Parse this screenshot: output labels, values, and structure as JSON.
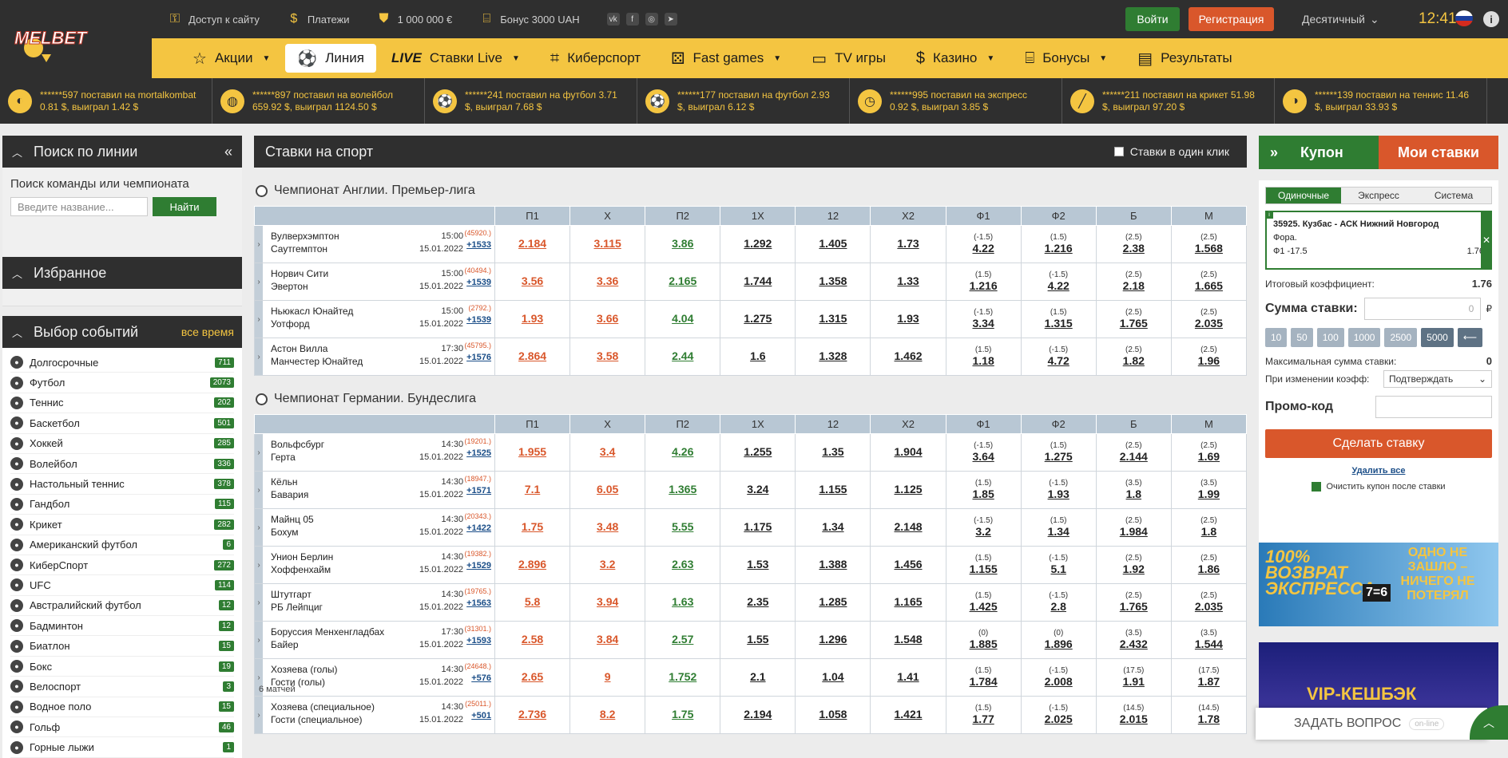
{
  "header": {
    "logo_text": "MELBET",
    "links": [
      {
        "icon": "key-icon",
        "label": "Доступ к сайту"
      },
      {
        "icon": "dollar-icon",
        "label": "Платежи"
      },
      {
        "icon": "shield-icon",
        "label": "1 000 000 €"
      },
      {
        "icon": "gift-icon",
        "label": "Бонус 3000 UAH"
      }
    ],
    "login": "Войти",
    "register": "Регистрация",
    "odds_format": "Десятичный",
    "time": "12:41"
  },
  "nav": [
    {
      "icon": "star-icon",
      "label": "Акции",
      "caret": "▼",
      "active": false
    },
    {
      "icon": "soccer-ball-icon",
      "label": "Линия",
      "caret": "",
      "active": true
    },
    {
      "icon": "live-icon",
      "label": "Ставки Live",
      "prefix": "LIVE",
      "caret": "▼",
      "active": false
    },
    {
      "icon": "gamepad-icon",
      "label": "Киберспорт",
      "caret": "",
      "active": false
    },
    {
      "icon": "dice-icon",
      "label": "Fast games",
      "caret": "▼",
      "active": false
    },
    {
      "icon": "tv-icon",
      "label": "TV игры",
      "caret": "",
      "active": false
    },
    {
      "icon": "casino-chip-icon",
      "label": "Казино",
      "caret": "▼",
      "active": false
    },
    {
      "icon": "gift-icon",
      "label": "Бонусы",
      "caret": "▼",
      "active": false
    },
    {
      "icon": "results-icon",
      "label": "Результаты",
      "caret": "",
      "active": false
    }
  ],
  "ticker": [
    {
      "icon": "mortalkombat-icon",
      "glyph": "◐",
      "line1": "******597 поставил на mortalkombat",
      "line2": "0.81 $, выиграл 1.42 $"
    },
    {
      "icon": "volleyball-icon",
      "glyph": "◍",
      "line1": "******897 поставил на волейбол",
      "line2": "659.92 $, выиграл 1124.50 $"
    },
    {
      "icon": "football-icon",
      "glyph": "⚽",
      "line1": "******241 поставил на футбол 3.71",
      "line2": "$, выиграл 7.68 $"
    },
    {
      "icon": "football-icon",
      "glyph": "⚽",
      "line1": "******177 поставил на футбол 2.93",
      "line2": "$, выиграл 6.12 $"
    },
    {
      "icon": "stopwatch-icon",
      "glyph": "◷",
      "line1": "******995 поставил на экспресс",
      "line2": "0.92 $, выиграл 3.85 $"
    },
    {
      "icon": "cricket-icon",
      "glyph": "╱",
      "line1": "******211 поставил на крикет 51.98",
      "line2": "$, выиграл 97.20 $"
    },
    {
      "icon": "tennis-icon",
      "glyph": "◑",
      "line1": "******139 поставил на теннис 11.46",
      "line2": "$, выиграл 33.93 $"
    }
  ],
  "left": {
    "search_title": "Поиск по линии",
    "search_label": "Поиск команды или чемпионата",
    "search_placeholder": "Введите название...",
    "search_button": "Найти",
    "favorites_title": "Избранное",
    "events_title": "Выбор событий",
    "all_time": "все время",
    "sports": [
      {
        "name": "Долгосрочные",
        "count": "711"
      },
      {
        "name": "Футбол",
        "count": "2073"
      },
      {
        "name": "Теннис",
        "count": "202"
      },
      {
        "name": "Баскетбол",
        "count": "501"
      },
      {
        "name": "Хоккей",
        "count": "285"
      },
      {
        "name": "Волейбол",
        "count": "336"
      },
      {
        "name": "Настольный теннис",
        "count": "378"
      },
      {
        "name": "Гандбол",
        "count": "115"
      },
      {
        "name": "Крикет",
        "count": "282"
      },
      {
        "name": "Американский футбол",
        "count": "6"
      },
      {
        "name": "КиберСпорт",
        "count": "272"
      },
      {
        "name": "UFC",
        "count": "114"
      },
      {
        "name": "Австралийский футбол",
        "count": "12"
      },
      {
        "name": "Бадминтон",
        "count": "12"
      },
      {
        "name": "Биатлон",
        "count": "15"
      },
      {
        "name": "Бокс",
        "count": "19"
      },
      {
        "name": "Велоспорт",
        "count": "3"
      },
      {
        "name": "Водное поло",
        "count": "15"
      },
      {
        "name": "Гольф",
        "count": "46"
      },
      {
        "name": "Горные лыжи",
        "count": "1"
      }
    ]
  },
  "main": {
    "title": "Ставки на спорт",
    "one_click": "Ставки в один клик",
    "columns": [
      "П1",
      "X",
      "П2",
      "1X",
      "12",
      "X2",
      "Ф1",
      "Ф2",
      "Б",
      "М"
    ],
    "leagues": [
      {
        "name": "Чемпионат Англии. Премьер-лига",
        "matches": [
          {
            "t1": "Вулверхэмптон",
            "t2": "Саутгемптон",
            "time": "15:00",
            "date": "15.01.2022",
            "id": "(45920.)",
            "plus": "+1533",
            "odds": [
              "2.184",
              "3.115",
              "3.86",
              "1.292",
              "1.405",
              "1.73"
            ],
            "hc": [
              "(-1.5)",
              "(1.5)",
              "(2.5)",
              "(2.5)"
            ],
            "ho": [
              "4.22",
              "1.216",
              "2.38",
              "1.568"
            ]
          },
          {
            "t1": "Норвич Сити",
            "t2": "Эвертон",
            "time": "15:00",
            "date": "15.01.2022",
            "id": "(40494.)",
            "plus": "+1539",
            "odds": [
              "3.56",
              "3.36",
              "2.165",
              "1.744",
              "1.358",
              "1.33"
            ],
            "hc": [
              "(1.5)",
              "(-1.5)",
              "(2.5)",
              "(2.5)"
            ],
            "ho": [
              "1.216",
              "4.22",
              "2.18",
              "1.665"
            ]
          },
          {
            "t1": "Ньюкасл Юнайтед",
            "t2": "Уотфорд",
            "time": "15:00",
            "date": "15.01.2022",
            "id": "(2792.)",
            "plus": "+1539",
            "odds": [
              "1.93",
              "3.66",
              "4.04",
              "1.275",
              "1.315",
              "1.93"
            ],
            "hc": [
              "(-1.5)",
              "(1.5)",
              "(2.5)",
              "(2.5)"
            ],
            "ho": [
              "3.34",
              "1.315",
              "1.765",
              "2.035"
            ]
          },
          {
            "t1": "Астон Вилла",
            "t2": "Манчестер Юнайтед",
            "time": "17:30",
            "date": "15.01.2022",
            "id": "(45795.)",
            "plus": "+1576",
            "odds": [
              "2.864",
              "3.58",
              "2.44",
              "1.6",
              "1.328",
              "1.462"
            ],
            "hc": [
              "(1.5)",
              "(-1.5)",
              "(2.5)",
              "(2.5)"
            ],
            "ho": [
              "1.18",
              "4.72",
              "1.82",
              "1.96"
            ]
          }
        ]
      },
      {
        "name": "Чемпионат Германии. Бундеслига",
        "matches": [
          {
            "t1": "Вольфсбург",
            "t2": "Герта",
            "time": "14:30",
            "date": "15.01.2022",
            "id": "(19201.)",
            "plus": "+1525",
            "odds": [
              "1.955",
              "3.4",
              "4.26",
              "1.255",
              "1.35",
              "1.904"
            ],
            "hc": [
              "(-1.5)",
              "(1.5)",
              "(2.5)",
              "(2.5)"
            ],
            "ho": [
              "3.64",
              "1.275",
              "2.144",
              "1.69"
            ]
          },
          {
            "t1": "Кёльн",
            "t2": "Бавария",
            "time": "14:30",
            "date": "15.01.2022",
            "id": "(18947.)",
            "plus": "+1571",
            "odds": [
              "7.1",
              "6.05",
              "1.365",
              "3.24",
              "1.155",
              "1.125"
            ],
            "hc": [
              "(1.5)",
              "(-1.5)",
              "(3.5)",
              "(3.5)"
            ],
            "ho": [
              "1.85",
              "1.93",
              "1.8",
              "1.99"
            ]
          },
          {
            "t1": "Майнц 05",
            "t2": "Бохум",
            "time": "14:30",
            "date": "15.01.2022",
            "id": "(20343.)",
            "plus": "+1422",
            "odds": [
              "1.75",
              "3.48",
              "5.55",
              "1.175",
              "1.34",
              "2.148"
            ],
            "hc": [
              "(-1.5)",
              "(1.5)",
              "(2.5)",
              "(2.5)"
            ],
            "ho": [
              "3.2",
              "1.34",
              "1.984",
              "1.8"
            ]
          },
          {
            "t1": "Унион Берлин",
            "t2": "Хоффенхайм",
            "time": "14:30",
            "date": "15.01.2022",
            "id": "(19382.)",
            "plus": "+1529",
            "odds": [
              "2.896",
              "3.2",
              "2.63",
              "1.53",
              "1.388",
              "1.456"
            ],
            "hc": [
              "(1.5)",
              "(-1.5)",
              "(2.5)",
              "(2.5)"
            ],
            "ho": [
              "1.155",
              "5.1",
              "1.92",
              "1.86"
            ]
          },
          {
            "t1": "Штутгарт",
            "t2": "РБ Лейпциг",
            "time": "14:30",
            "date": "15.01.2022",
            "id": "(19765.)",
            "plus": "+1563",
            "odds": [
              "5.8",
              "3.94",
              "1.63",
              "2.35",
              "1.285",
              "1.165"
            ],
            "hc": [
              "(1.5)",
              "(-1.5)",
              "(2.5)",
              "(2.5)"
            ],
            "ho": [
              "1.425",
              "2.8",
              "1.765",
              "2.035"
            ]
          },
          {
            "t1": "Боруссия Менхенгладбах",
            "t2": "Байер",
            "time": "17:30",
            "date": "15.01.2022",
            "id": "(31301.)",
            "plus": "+1593",
            "odds": [
              "2.58",
              "3.84",
              "2.57",
              "1.55",
              "1.296",
              "1.548"
            ],
            "hc": [
              "(0)",
              "(0)",
              "(3.5)",
              "(3.5)"
            ],
            "ho": [
              "1.885",
              "1.896",
              "2.432",
              "1.544"
            ]
          },
          {
            "t1": "Хозяева (голы)",
            "t2": "Гости (голы)",
            "time": "14:30",
            "date": "15.01.2022",
            "id": "(24648.)",
            "plus": "+576",
            "odds": [
              "2.65",
              "9",
              "1.752",
              "2.1",
              "1.04",
              "1.41"
            ],
            "hc": [
              "(1.5)",
              "(-1.5)",
              "(17.5)",
              "(17.5)"
            ],
            "ho": [
              "1.784",
              "2.008",
              "1.91",
              "1.87"
            ],
            "extra": "6 матчей"
          },
          {
            "t1": "Хозяева (специальное)",
            "t2": "Гости (специальное)",
            "time": "14:30",
            "date": "15.01.2022",
            "id": "(25011.)",
            "plus": "+501",
            "odds": [
              "2.736",
              "8.2",
              "1.75",
              "2.194",
              "1.058",
              "1.421"
            ],
            "hc": [
              "(1.5)",
              "(-1.5)",
              "(14.5)",
              "(14.5)"
            ],
            "ho": [
              "1.77",
              "2.025",
              "2.015",
              "1.78"
            ]
          }
        ]
      }
    ]
  },
  "coupon": {
    "tab_coupon": "Купон",
    "tab_my": "Мои ставки",
    "types": [
      "Одиночные",
      "Экспресс",
      "Система"
    ],
    "event": "35925. Кузбас - АСК Нижний Новгород",
    "market": "Фора.",
    "pick": "Ф1 -17.5",
    "pick_odd": "1.76",
    "total_label": "Итоговый коэффициент:",
    "total": "1.76",
    "stake_label": "Сумма ставки:",
    "stake_value": "0",
    "currency": "₽",
    "chips": [
      "10",
      "50",
      "100",
      "1000",
      "2500",
      "5000"
    ],
    "max_label": "Максимальная сумма ставки:",
    "max_value": "0",
    "change_label": "При изменении коэфф:",
    "change_value": "Подтверждать",
    "promo_label": "Промо-код",
    "make_bet": "Сделать ставку",
    "delete_all": "Удалить все",
    "clear_after": "Очистить купон после ставки"
  },
  "banners": {
    "b1_left": "100% ВОЗВРАТ ЭКСПРЕССА",
    "b1_right": "ОДНО НЕ ЗАШЛО – НИЧЕГО НЕ ПОТЕРЯЛ",
    "b1_score": "7=6",
    "b2": "VIP-КЕШБЭК"
  },
  "chat": {
    "label": "ЗАДАТЬ ВОПРОС",
    "status": "on-line"
  }
}
